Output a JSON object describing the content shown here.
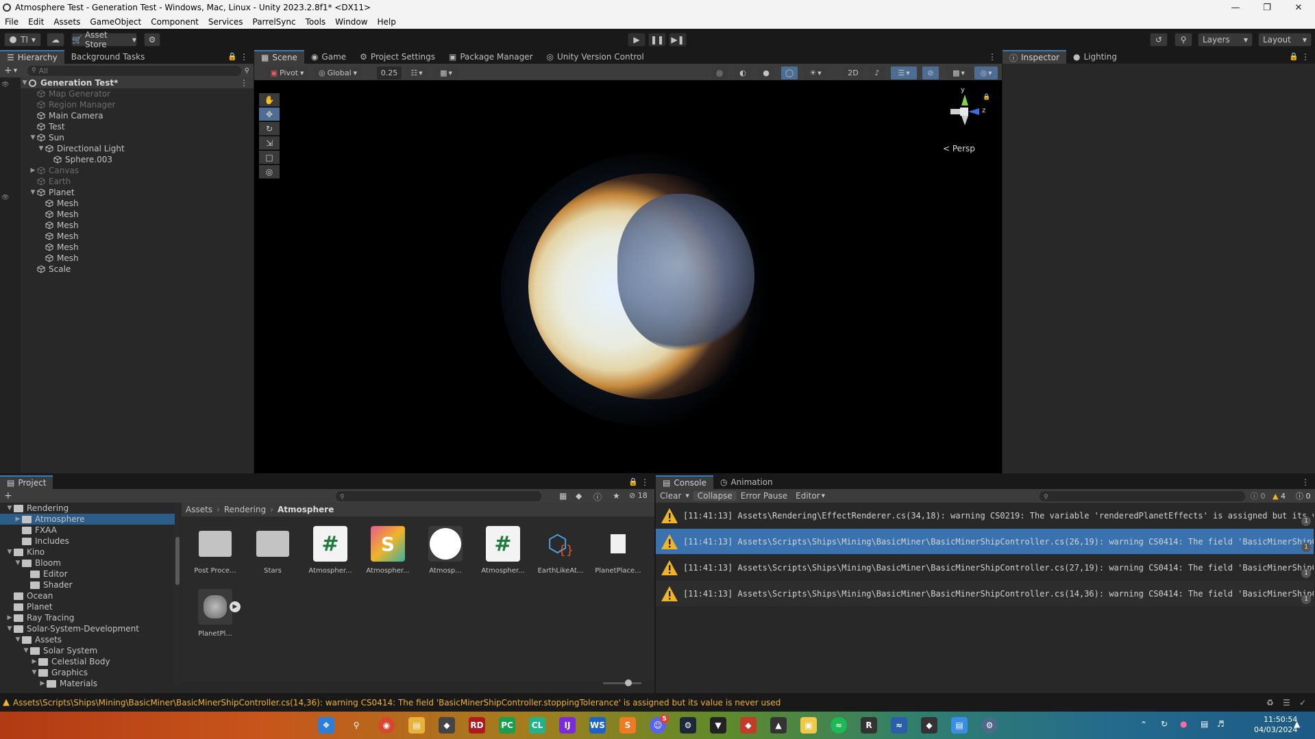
{
  "window": {
    "title": "Atmosphere Test - Generation Test - Windows, Mac, Linux - Unity 2023.2.8f1* <DX11>"
  },
  "menu": [
    "File",
    "Edit",
    "Assets",
    "GameObject",
    "Component",
    "Services",
    "ParrelSync",
    "Tools",
    "Window",
    "Help"
  ],
  "toolbar": {
    "account": "TI",
    "asset_store": "Asset Store",
    "layers": "Layers",
    "layout": "Layout"
  },
  "hierarchy": {
    "tabs": [
      "Hierarchy",
      "Background Tasks"
    ],
    "search_placeholder": "All",
    "scene": "Generation Test*",
    "items": [
      {
        "label": "Map Generator",
        "dim": true,
        "depth": 1
      },
      {
        "label": "Region Manager",
        "dim": true,
        "depth": 1
      },
      {
        "label": "Main Camera",
        "dim": false,
        "depth": 1
      },
      {
        "label": "Test",
        "dim": false,
        "depth": 1
      },
      {
        "label": "Sun",
        "dim": false,
        "depth": 1,
        "expanded": true
      },
      {
        "label": "Directional Light",
        "dim": false,
        "depth": 2,
        "expanded": true
      },
      {
        "label": "Sphere.003",
        "dim": false,
        "depth": 3
      },
      {
        "label": "Canvas",
        "dim": true,
        "depth": 1,
        "collapsed": true
      },
      {
        "label": "Earth",
        "dim": true,
        "depth": 1
      },
      {
        "label": "Planet",
        "dim": false,
        "depth": 1,
        "expanded": true
      },
      {
        "label": "Mesh",
        "dim": false,
        "depth": 2
      },
      {
        "label": "Mesh",
        "dim": false,
        "depth": 2
      },
      {
        "label": "Mesh",
        "dim": false,
        "depth": 2
      },
      {
        "label": "Mesh",
        "dim": false,
        "depth": 2
      },
      {
        "label": "Mesh",
        "dim": false,
        "depth": 2
      },
      {
        "label": "Mesh",
        "dim": false,
        "depth": 2
      },
      {
        "label": "Scale",
        "dim": false,
        "depth": 1
      }
    ]
  },
  "scene_view": {
    "tabs": [
      "Scene",
      "Game",
      "Project Settings",
      "Package Manager",
      "Unity Version Control"
    ],
    "pivot": "Pivot",
    "global": "Global",
    "grid_snap": "0.25",
    "mode_2d": "2D",
    "persp": "Persp",
    "gizmo_axes": {
      "y": "y",
      "z": "z"
    }
  },
  "inspector": {
    "tabs": [
      "Inspector",
      "Lighting"
    ]
  },
  "project": {
    "tab": "Project",
    "hidden_count": "18",
    "breadcrumb": [
      "Assets",
      "Rendering",
      "Atmosphere"
    ],
    "tree": [
      {
        "label": "Rendering",
        "depth": 1,
        "arrow": "▼"
      },
      {
        "label": "Atmosphere",
        "depth": 2,
        "arrow": "▶",
        "selected": true
      },
      {
        "label": "FXAA",
        "depth": 2,
        "arrow": ""
      },
      {
        "label": "Includes",
        "depth": 2,
        "arrow": ""
      },
      {
        "label": "Kino",
        "depth": 1,
        "arrow": "▼"
      },
      {
        "label": "Bloom",
        "depth": 2,
        "arrow": "▼"
      },
      {
        "label": "Editor",
        "depth": 3,
        "arrow": ""
      },
      {
        "label": "Shader",
        "depth": 3,
        "arrow": ""
      },
      {
        "label": "Ocean",
        "depth": 1,
        "arrow": ""
      },
      {
        "label": "Planet",
        "depth": 1,
        "arrow": ""
      },
      {
        "label": "Ray Tracing",
        "depth": 1,
        "arrow": "▶"
      },
      {
        "label": "Solar-System-Development",
        "depth": 1,
        "arrow": "▼"
      },
      {
        "label": "Assets",
        "depth": 2,
        "arrow": "▼"
      },
      {
        "label": "Solar System",
        "depth": 3,
        "arrow": "▼"
      },
      {
        "label": "Celestial Body",
        "depth": 4,
        "arrow": "▶"
      },
      {
        "label": "Graphics",
        "depth": 4,
        "arrow": "▼"
      },
      {
        "label": "Materials",
        "depth": 5,
        "arrow": "▶"
      }
    ],
    "assets": [
      {
        "label": "Post Proce...",
        "kind": "folder"
      },
      {
        "label": "Stars",
        "kind": "folder"
      },
      {
        "label": "Atmospher...",
        "kind": "script"
      },
      {
        "label": "Atmospher...",
        "kind": "shader"
      },
      {
        "label": "Atmosp...",
        "kind": "material"
      },
      {
        "label": "Atmospher...",
        "kind": "script"
      },
      {
        "label": "EarthLikeAt...",
        "kind": "json"
      },
      {
        "label": "PlanetPlace...",
        "kind": "file"
      },
      {
        "label": "PlanetPl...",
        "kind": "prefab"
      }
    ]
  },
  "console": {
    "tabs": [
      "Console",
      "Animation"
    ],
    "buttons": {
      "clear": "Clear",
      "collapse": "Collapse",
      "error_pause": "Error Pause",
      "editor": "Editor"
    },
    "counts": {
      "info": "0",
      "warn": "4",
      "error": "0"
    },
    "entries": [
      {
        "text": "[11:41:13] Assets\\Rendering\\EffectRenderer.cs(34,18): warning CS0219: The variable 'renderedPlanetEffects' is assigned but its v",
        "count": "1",
        "selected": false
      },
      {
        "text": "[11:41:13] Assets\\Scripts\\Ships\\Mining\\BasicMiner\\BasicMinerShipController.cs(26,19): warning CS0414: The field 'BasicMinerShipC",
        "count": "1",
        "selected": true
      },
      {
        "text": "[11:41:13] Assets\\Scripts\\Ships\\Mining\\BasicMiner\\BasicMinerShipController.cs(27,19): warning CS0414: The field 'BasicMinerShipC",
        "count": "1",
        "selected": false
      },
      {
        "text": "[11:41:13] Assets\\Scripts\\Ships\\Mining\\BasicMiner\\BasicMinerShipController.cs(14,36): warning CS0414: The field 'BasicMinerShipC",
        "count": "1",
        "selected": false
      }
    ]
  },
  "status_bar": {
    "message": "Assets\\Scripts\\Ships\\Mining\\BasicMiner\\BasicMinerShipController.cs(14,36): warning CS0414: The field 'BasicMinerShipController.stoppingTolerance' is assigned but its value is never used"
  },
  "taskbar": {
    "time": "11:50:54",
    "date": "04/03/2024",
    "discord_badge": "5"
  },
  "colors": {
    "accent": "#3a79bb",
    "selected_row": "#2c5d87",
    "console_selected": "#3a72b0",
    "warn": "#f0b428"
  }
}
